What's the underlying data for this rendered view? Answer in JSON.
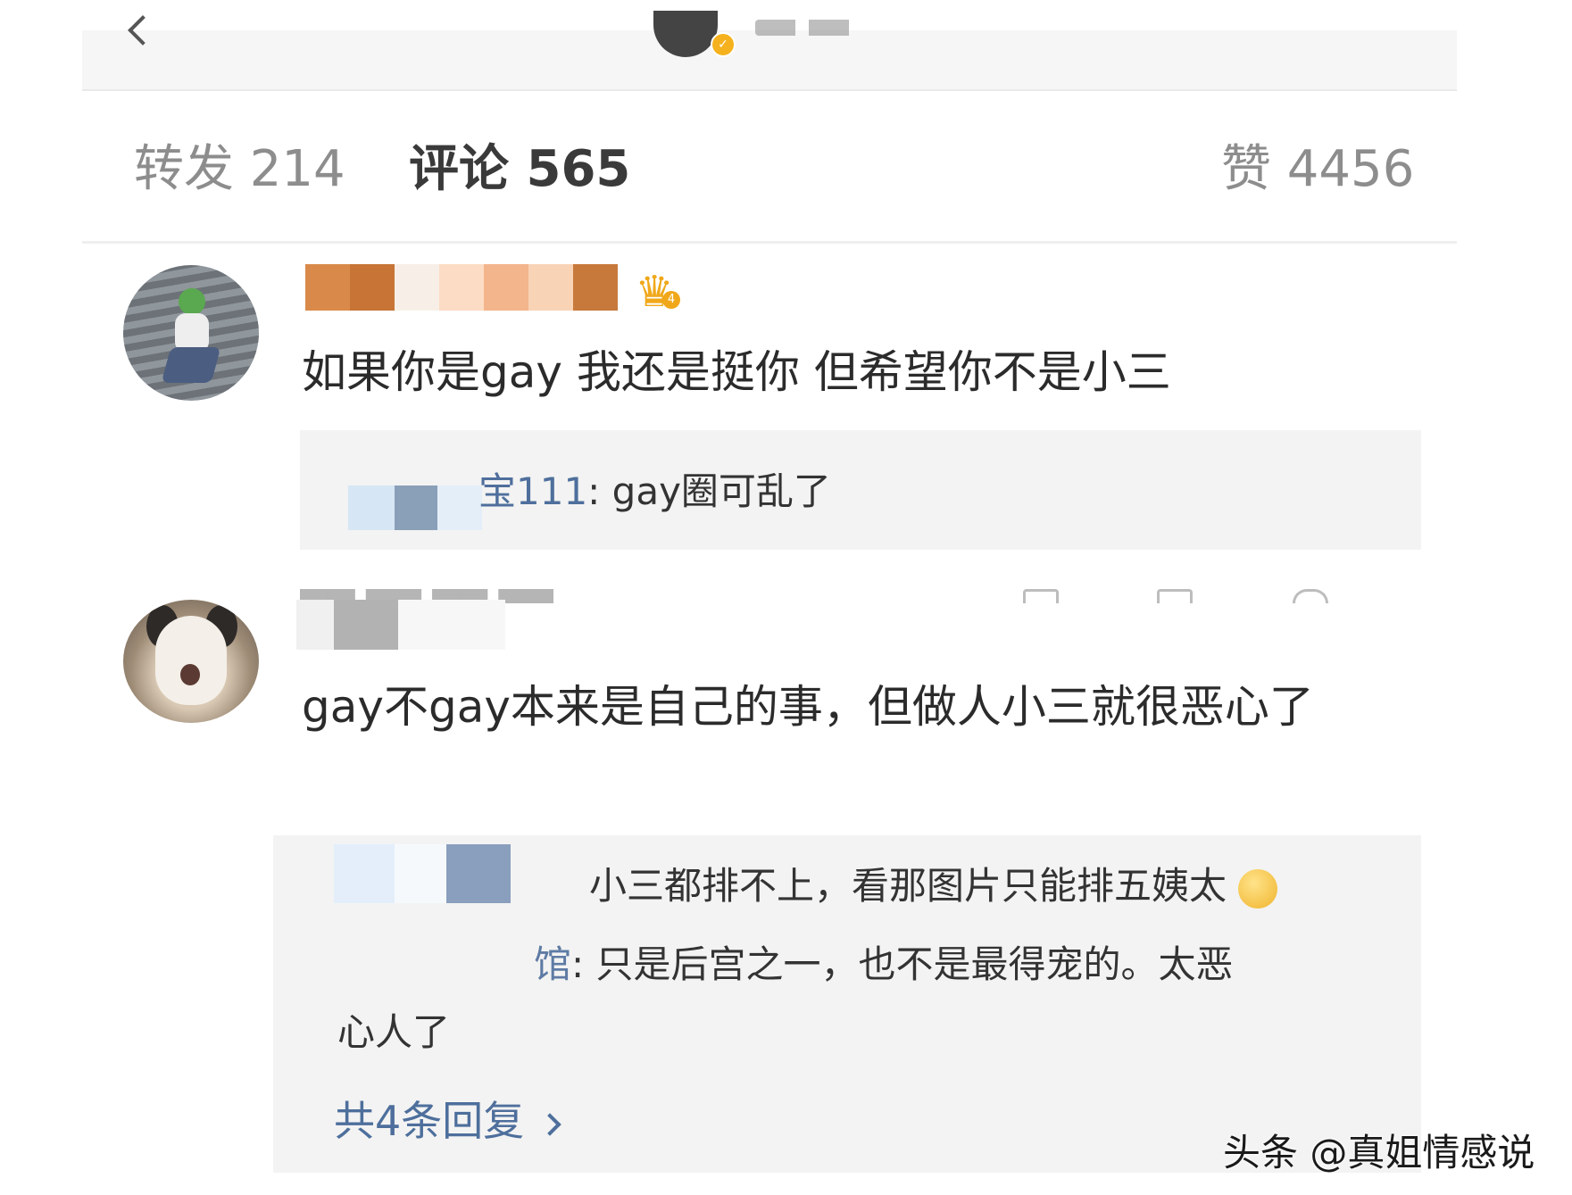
{
  "tabs": {
    "reposts": "转发 214",
    "comments": "评论 565",
    "likes": "赞 4456"
  },
  "header": {
    "verified_icon": "check-icon"
  },
  "comments": [
    {
      "text": "如果你是gay 我还是挺你 但希望你不是小三",
      "badge_icon": "crown-icon",
      "badge_level": "4",
      "replies": [
        {
          "name_fragment": "宝111",
          "text": ": gay圈可乱了"
        }
      ]
    },
    {
      "text": "gay不gay本来是自己的事，但做人小三就很恶心了",
      "replies": [
        {
          "text": "小三都排不上，看那图片只能排五姨太"
        },
        {
          "name_fragment": "馆",
          "text": ": 只是后宫之一，也不是最得宠的。太恶"
        },
        {
          "text": "心人了"
        }
      ],
      "more_replies": "共4条回复"
    }
  ],
  "watermark": "头条 @真姐情感说",
  "colors": {
    "link": "#4e6f9c",
    "reply_bg": "#f3f3f3",
    "badge": "#f0a81a"
  }
}
